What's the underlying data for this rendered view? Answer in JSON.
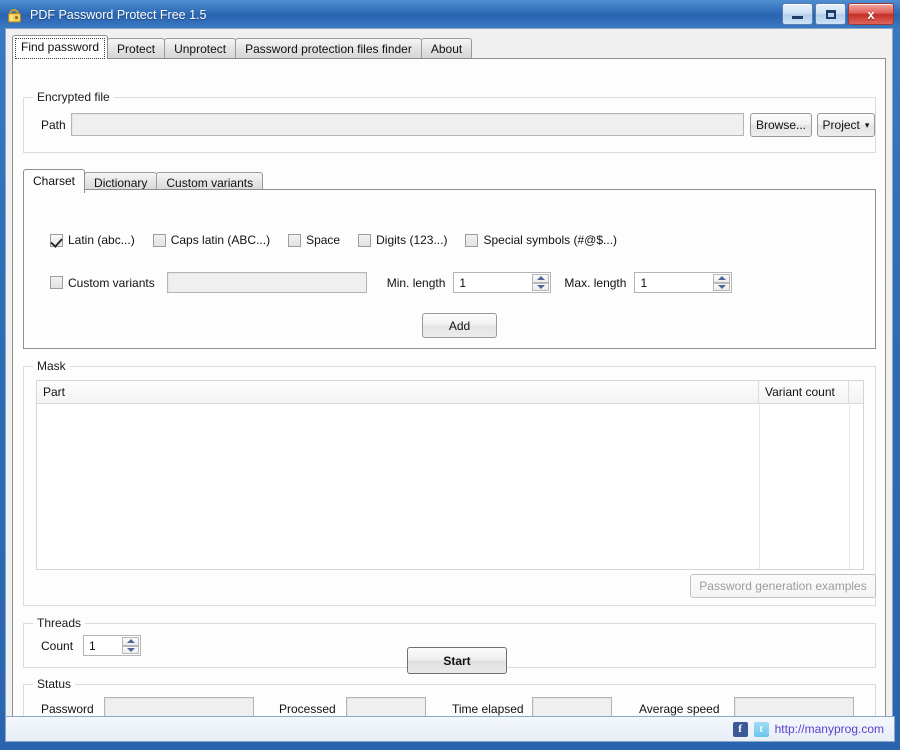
{
  "window": {
    "title": "PDF Password Protect Free 1.5",
    "app_icon": "padlock-icon",
    "buttons": {
      "minimize": "minimize-icon",
      "maximize": "maximize-icon",
      "close": "x"
    }
  },
  "tabs": [
    {
      "label": "Find password",
      "active": true
    },
    {
      "label": "Protect",
      "active": false
    },
    {
      "label": "Unprotect",
      "active": false
    },
    {
      "label": "Password protection files finder",
      "active": false
    },
    {
      "label": "About",
      "active": false
    }
  ],
  "encrypted_file": {
    "group_label": "Encrypted file",
    "path_label": "Path",
    "path_value": "",
    "browse_label": "Browse...",
    "project_label": "Project",
    "project_caret": "▾"
  },
  "charset_tabs": [
    {
      "label": "Charset",
      "active": true
    },
    {
      "label": "Dictionary",
      "active": false
    },
    {
      "label": "Custom variants",
      "active": false
    }
  ],
  "charset": {
    "checkboxes": [
      {
        "label": "Latin (abc...)",
        "checked": true
      },
      {
        "label": "Caps latin (ABC...)",
        "checked": false
      },
      {
        "label": "Space",
        "checked": false
      },
      {
        "label": "Digits (123...)",
        "checked": false
      },
      {
        "label": "Special symbols (#@$...)",
        "checked": false
      }
    ],
    "custom_variants_label": "Custom variants",
    "custom_variants_checked": false,
    "custom_variants_value": "",
    "min_length_label": "Min. length",
    "min_length_value": "1",
    "max_length_label": "Max. length",
    "max_length_value": "1",
    "add_label": "Add"
  },
  "mask": {
    "group_label": "Mask",
    "columns": [
      "Part",
      "Variant count"
    ],
    "rows": [],
    "examples_button": "Password generation examples",
    "examples_disabled": true
  },
  "threads": {
    "group_label": "Threads",
    "count_label": "Count",
    "count_value": "1"
  },
  "start_button": "Start",
  "status": {
    "group_label": "Status",
    "fields": [
      {
        "label": "Password",
        "value": ""
      },
      {
        "label": "Processed",
        "value": ""
      },
      {
        "label": "Time elapsed",
        "value": ""
      },
      {
        "label": "Average speed",
        "value": ""
      }
    ]
  },
  "statusbar": {
    "facebook_icon": "f",
    "twitter_icon": "t",
    "link": "http://manyprog.com"
  }
}
